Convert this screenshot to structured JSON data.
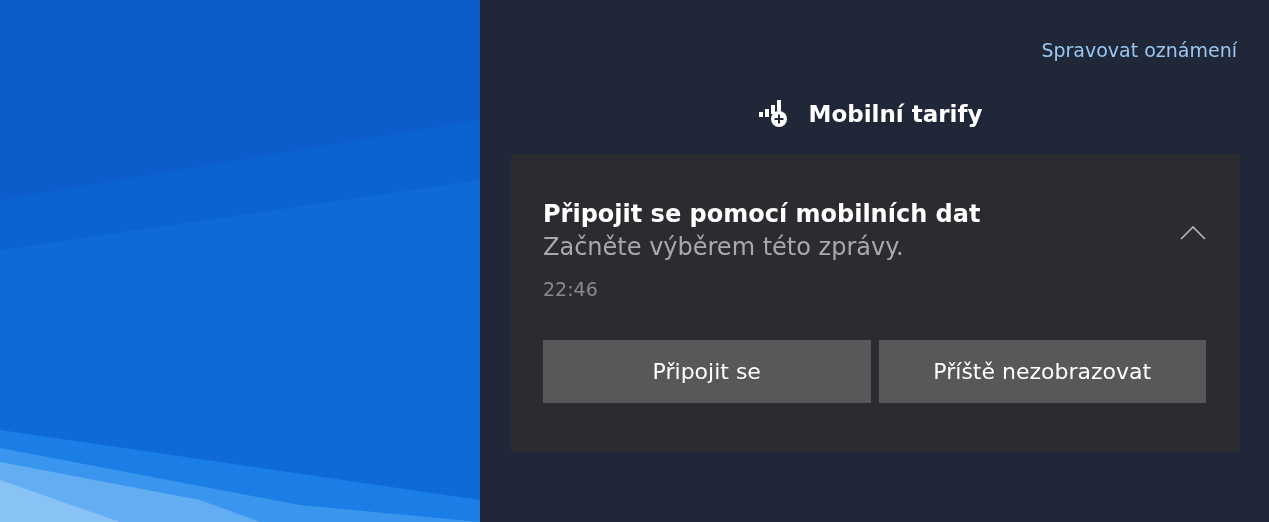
{
  "manage_link": "Spravovat oznámení",
  "group": {
    "title": "Mobilní tarify"
  },
  "notification": {
    "title": "Připojit se pomocí mobilních dat",
    "body": "Začněte výběrem této zprávy.",
    "time": "22:46",
    "expanded": true,
    "buttons": [
      "Připojit se",
      "Příště nezobrazovat"
    ]
  }
}
